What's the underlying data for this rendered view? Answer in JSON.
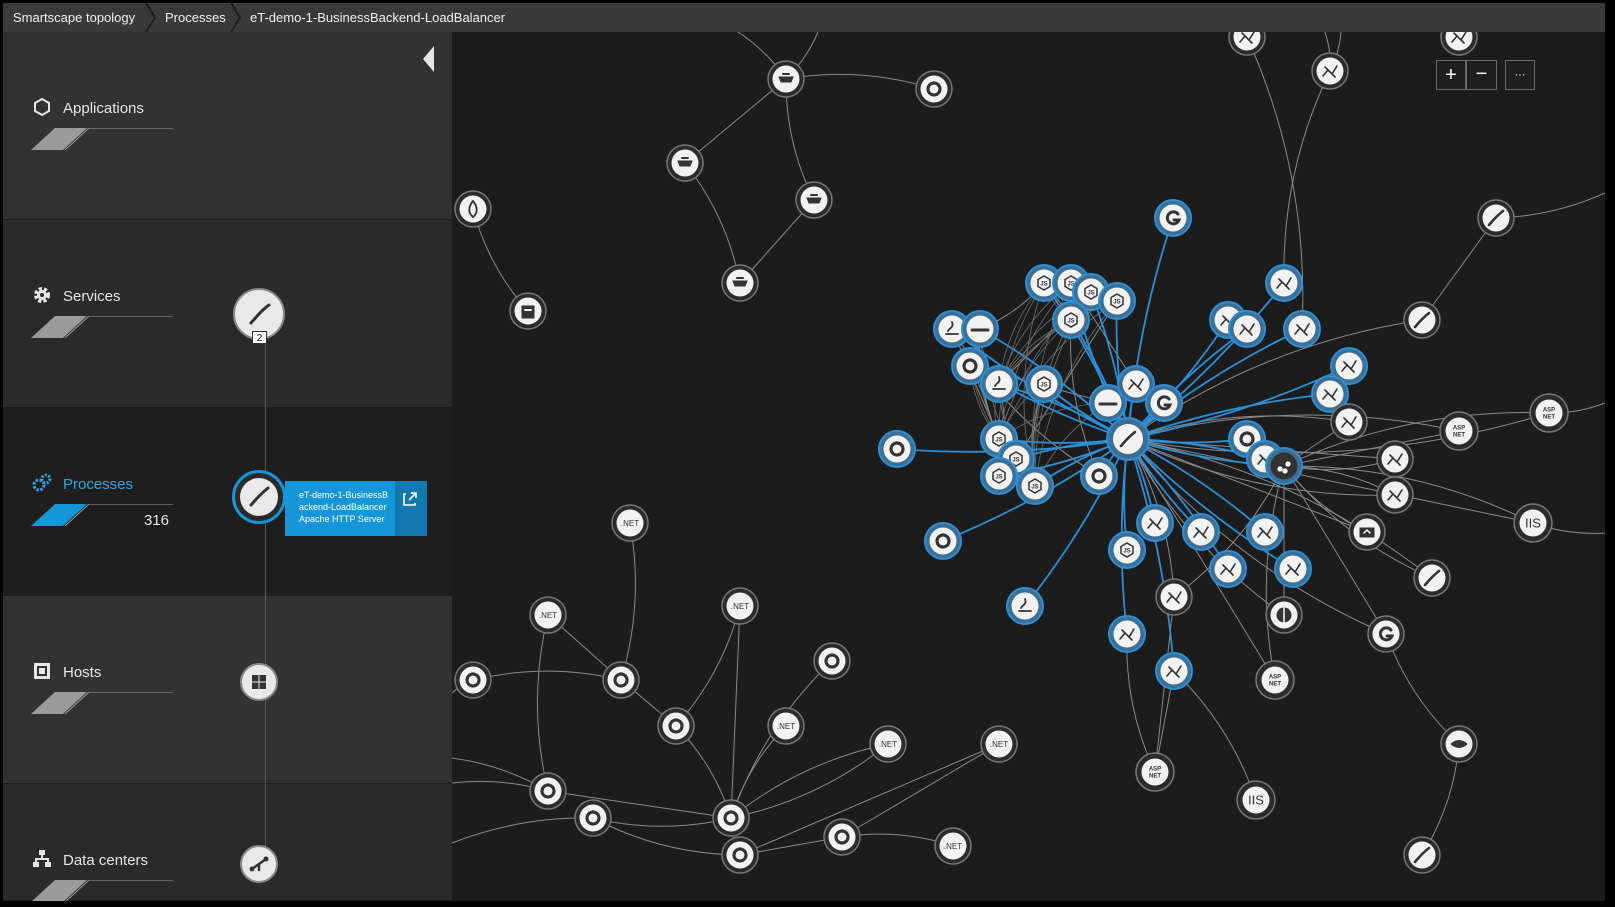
{
  "breadcrumb": {
    "items": [
      {
        "label": "Smartscape topology"
      },
      {
        "label": "Processes"
      },
      {
        "label": "eT-demo-1-BusinessBackend-LoadBalancer"
      }
    ]
  },
  "sidebar": {
    "layers": [
      {
        "label": "Applications",
        "icon": "hexagon-icon"
      },
      {
        "label": "Services",
        "icon": "gear-icon"
      },
      {
        "label": "Processes",
        "icon": "processes-icon",
        "count": "316",
        "active": true
      },
      {
        "label": "Hosts",
        "icon": "host-icon"
      },
      {
        "label": "Data centers",
        "icon": "datacenter-icon"
      }
    ],
    "service_badge": "2",
    "selected_process": {
      "name_line1": "eT-demo-1-BusinessB",
      "name_line2": "ackend-LoadBalancer",
      "type": "Apache HTTP Server"
    }
  },
  "map": {
    "node_labels": {
      "dotnet": ".NET",
      "aspnet_line1": "ASP",
      "aspnet_line2": "NET",
      "iis": "IIS",
      "golang": "G",
      "nodejs": "JS"
    }
  },
  "zoom": {
    "plus": "+",
    "minus": "−",
    "more": "···"
  },
  "colors": {
    "accent": "#1596d8",
    "highlight_edge": "#2b8fd6",
    "edge": "#8a8a8a",
    "node_fill": "#f2f2f2",
    "highlight_node": "#3d6f95"
  }
}
